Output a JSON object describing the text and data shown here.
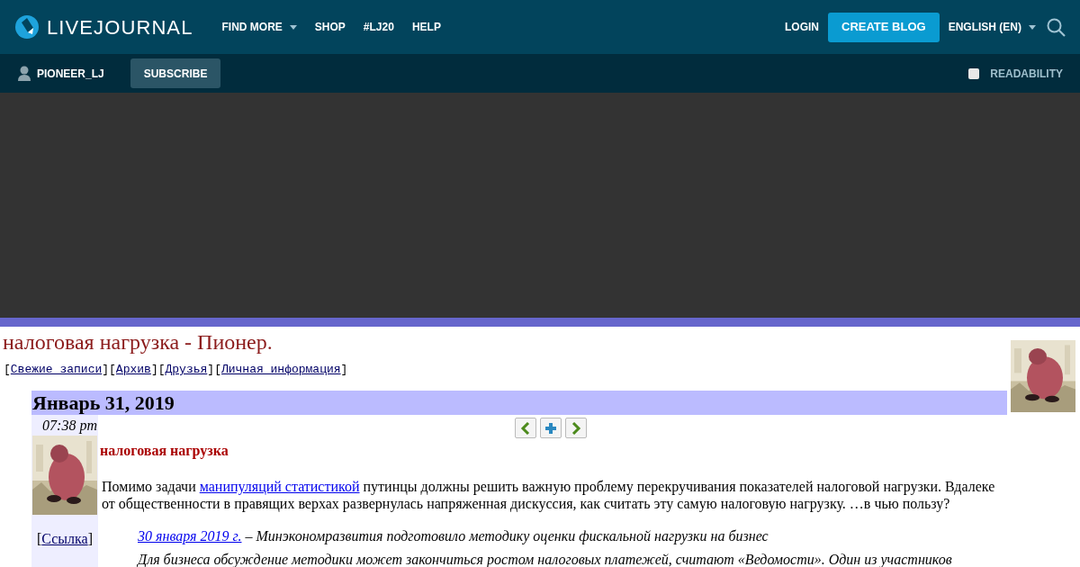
{
  "header": {
    "logo": "LIVEJOURNAL",
    "nav": [
      {
        "label": "FIND MORE",
        "dropdown": true
      },
      {
        "label": "SHOP",
        "dropdown": false
      },
      {
        "label": "#LJ20",
        "dropdown": false
      },
      {
        "label": "HELP",
        "dropdown": false
      }
    ],
    "login": "LOGIN",
    "create_blog": "CREATE BLOG",
    "language": "ENGLISH (EN)"
  },
  "subheader": {
    "user": "PIONEER_LJ",
    "subscribe": "SUBSCRIBE",
    "readability": {
      "label": "READABILITY",
      "checked": false
    }
  },
  "journal": {
    "title": "налоговая нагрузка - Пионер.",
    "links": [
      {
        "open": "[",
        "label": "Свежие записи",
        "close": "]"
      },
      {
        "open": "[",
        "label": "Архив",
        "close": "]"
      },
      {
        "open": "[",
        "label": "Друзья",
        "close": "]"
      },
      {
        "open": "[",
        "label": "Личная информация",
        "close": "]"
      }
    ]
  },
  "day": {
    "date": "Январь 31, 2019"
  },
  "entry": {
    "time": "07:38 pm",
    "permalink": {
      "open": "[",
      "label": "Ссылка",
      "close": "]"
    },
    "subject": "налоговая нагрузка",
    "body": {
      "before": "Помимо задачи ",
      "link": "манипуляций статистикой",
      "after": " путинцы должны решить важную проблему перекручивания показателей налоговой нагрузки. Вдалеке от общественности в правящих верхах развернулась напряженная дискуссия, как считать эту самую налоговую нагрузку. …в чью пользу?"
    },
    "quote": [
      {
        "link": "30 января 2019 г.",
        "text": " – Минэкономразвития подготовило методику оценки фискальной нагрузки на бизнес"
      },
      {
        "text": "Для бизнеса обсуждение методики может закончиться ростом налоговых платежей, считают «Ведомости». Один из участников"
      }
    ]
  }
}
